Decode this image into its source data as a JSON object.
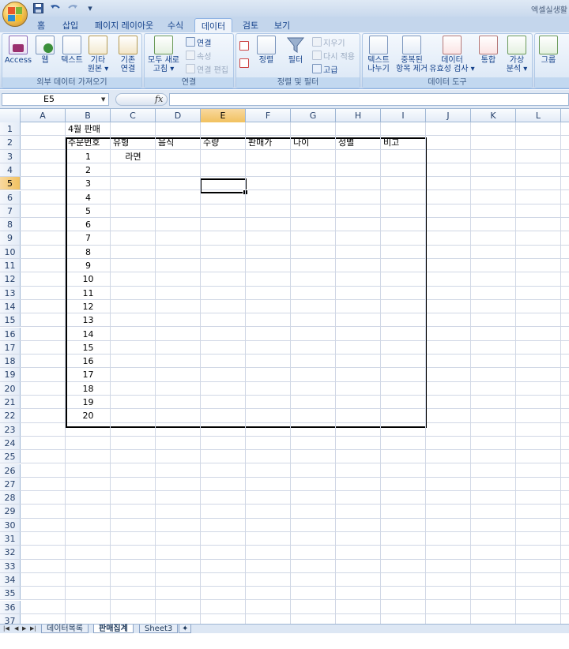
{
  "window": {
    "title": "엑셀실생활"
  },
  "quick_access": {
    "save_icon": "save-icon",
    "undo_icon": "undo-icon",
    "redo_icon": "redo-icon",
    "customize": "▾"
  },
  "tabs": [
    "홈",
    "삽입",
    "페이지 레이아웃",
    "수식",
    "데이터",
    "검토",
    "보기"
  ],
  "active_tab": "데이터",
  "ribbon": {
    "groups": {
      "external": "외부 데이터 가져오기",
      "connections": "연결",
      "sort_filter": "정렬 및 필터",
      "data_tools": "데이터 도구"
    },
    "buttons": {
      "access": "Access",
      "web": "웹",
      "text": "텍스트",
      "other_sources_1": "기타",
      "other_sources_2": "원본 ▾",
      "existing_1": "기존",
      "existing_2": "연결",
      "refresh_1": "모두 새로",
      "refresh_2": "고침 ▾",
      "connections": "연결",
      "properties": "속성",
      "edit_links": "연결 편집",
      "sort_az": "",
      "sort": "정렬",
      "filter": "필터",
      "clear": "지우기",
      "reapply": "다시 적용",
      "advanced": "고급",
      "text_to_columns_1": "텍스트",
      "text_to_columns_2": "나누기",
      "remove_dup_1": "중복된",
      "remove_dup_2": "항목 제거",
      "validation_1": "데이터",
      "validation_2": "유효성 검사 ▾",
      "consolidate": "통합",
      "whatif_1": "가상",
      "whatif_2": "분석 ▾",
      "group": "그룹"
    }
  },
  "formula_bar": {
    "name_box": "E5",
    "fx": "fx",
    "value": ""
  },
  "columns": [
    "A",
    "B",
    "C",
    "D",
    "E",
    "F",
    "G",
    "H",
    "I",
    "J",
    "K",
    "L"
  ],
  "selected_column": "E",
  "selected_row": 5,
  "row_numbers": [
    "1",
    "2",
    "3",
    "4",
    "5",
    "6",
    "7",
    "8",
    "9",
    "10",
    "11",
    "12",
    "13",
    "14",
    "15",
    "16",
    "17",
    "18",
    "19",
    "20",
    "21",
    "22",
    "23",
    "24",
    "25",
    "26",
    "27",
    "28",
    "29",
    "30",
    "31",
    "32",
    "33",
    "34",
    "35",
    "36",
    "37"
  ],
  "sheet_title": "4월 판매",
  "headers": [
    "주문번호",
    "유형",
    "음식",
    "수량",
    "판매가",
    "나이",
    "성별",
    "비고"
  ],
  "order_numbers": [
    "1",
    "2",
    "3",
    "4",
    "5",
    "6",
    "7",
    "8",
    "9",
    "10",
    "11",
    "12",
    "13",
    "14",
    "15",
    "16",
    "17",
    "18",
    "19",
    "20"
  ],
  "c3_value": "라면",
  "sheet_tabs": [
    "데이터목록",
    "판매집계",
    "Sheet3"
  ],
  "active_sheet": "판매집계"
}
